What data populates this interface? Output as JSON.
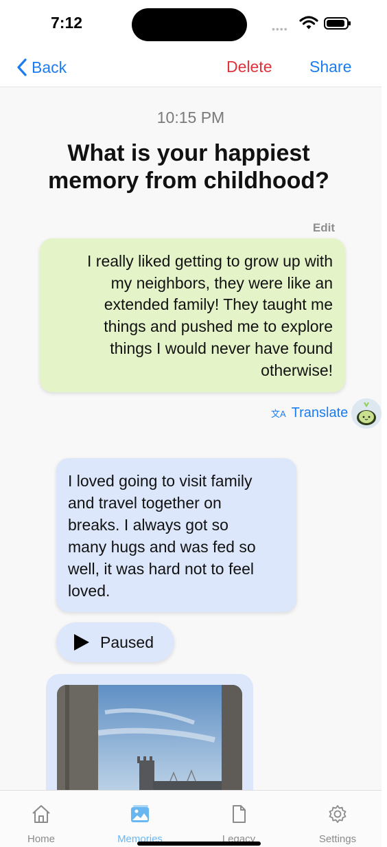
{
  "status_bar": {
    "time": "7:12"
  },
  "nav": {
    "back_label": "Back",
    "delete_label": "Delete",
    "share_label": "Share"
  },
  "conversation": {
    "timestamp": "10:15 PM",
    "question": "What is your happiest memory from childhood?",
    "edit_label": "Edit",
    "user_answer_lines": [
      "I really liked getting to grow up with",
      "my neighbors, they were like an",
      "extended family! They taught me",
      "things and pushed me to explore",
      "things I would never have found",
      "otherwise!"
    ],
    "translate_label": "Translate",
    "ai_reply_lines": [
      "I loved going to visit family",
      "and travel together on",
      "breaks. I always got so",
      "many hugs and was fed so",
      "well, it was hard not to feel",
      "loved."
    ],
    "audio_state": "Paused"
  },
  "tabbar": {
    "items": [
      {
        "label": "Home",
        "icon": "house-icon",
        "active": false
      },
      {
        "label": "Memories",
        "icon": "photos-icon",
        "active": true
      },
      {
        "label": "Legacy",
        "icon": "document-icon",
        "active": false
      },
      {
        "label": "Settings",
        "icon": "gear-icon",
        "active": false
      }
    ]
  },
  "colors": {
    "accent": "#1a7cf0",
    "destructive": "#e0323b",
    "user_bubble": "#e5f3c9",
    "ai_bubble": "#dde7fb",
    "active_tab": "#69b7f0"
  }
}
